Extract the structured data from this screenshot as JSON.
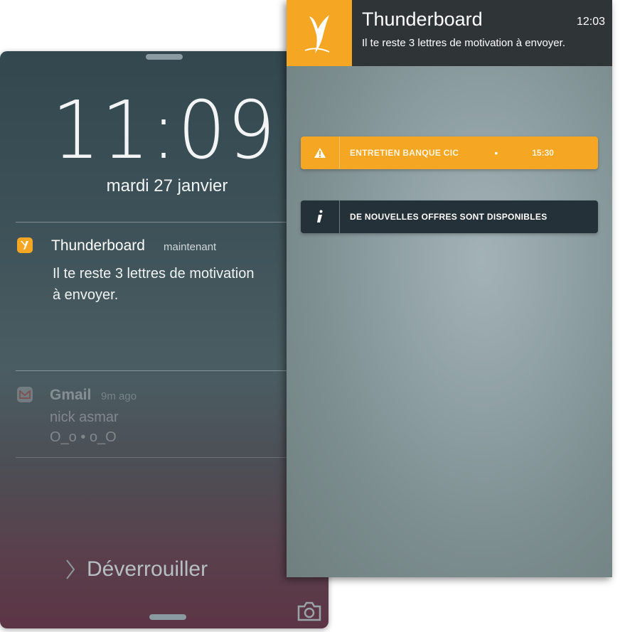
{
  "lock_screen": {
    "time": "11:09",
    "date": "mardi 27 janvier",
    "notifications": [
      {
        "app": "Thunderboard",
        "ago": "maintenant",
        "line1": "Il te reste 3 lettres de motivation",
        "line2": "à envoyer.",
        "icon": "thunderboard-app-icon",
        "accent": "#f5a623"
      },
      {
        "app": "Gmail",
        "ago": "9m ago",
        "line1": "nick asmar",
        "line2": "O_o • o_O",
        "icon": "gmail-icon",
        "accent": "#c4c9cb"
      }
    ],
    "unlock_label": "Déverrouiller",
    "camera_icon": "camera-icon"
  },
  "app_screen": {
    "header": {
      "title": "Thunderboard",
      "time": "12:03",
      "message": "Il te reste 3 lettres de motivation à envoyer.",
      "logo": "thunderboard-logo"
    },
    "cards": {
      "alert": {
        "icon": "warning-icon",
        "label": "ENTRETIEN BANQUE CIC",
        "separator": "•",
        "time": "15:30",
        "color": "#f5a623"
      },
      "info": {
        "icon": "info-icon",
        "label": "DE NOUVELLES OFFRES SONT DISPONIBLES",
        "color": "#253139"
      }
    }
  }
}
